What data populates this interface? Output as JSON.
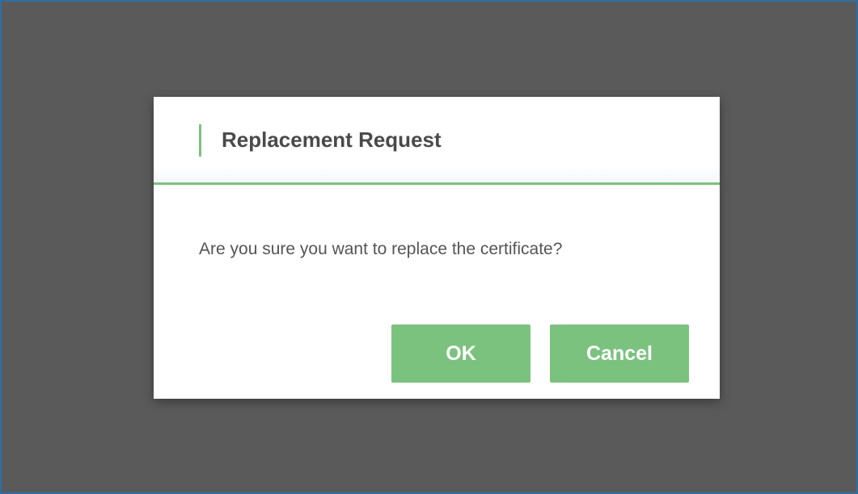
{
  "dialog": {
    "title": "Replacement Request",
    "message": "Are you sure you want to replace the certificate?",
    "ok_label": "OK",
    "cancel_label": "Cancel"
  },
  "colors": {
    "overlay": "#5a5a5a",
    "accent": "#7cc27f",
    "frame_border": "#2f6ea3"
  }
}
